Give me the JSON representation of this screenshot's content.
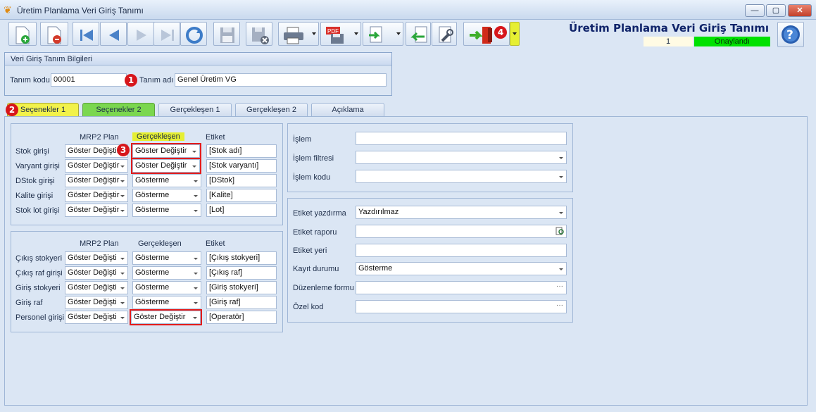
{
  "window": {
    "title": "Üretim Planlama Veri Giriş Tanımı",
    "min": "—",
    "max": "▢",
    "close": "✕"
  },
  "header": {
    "title": "Üretim Planlama Veri Giriş Tanımı",
    "record_no": "1",
    "status": "Onaylandı",
    "status_color": "#00e100"
  },
  "toolbar": {
    "buttons": [
      "new-icon",
      "delete-icon",
      "first-icon",
      "prev-icon",
      "next-icon",
      "last-icon",
      "refresh-icon",
      "save-icon",
      "cancel-save-icon",
      "print-icon",
      "pdf-export-icon",
      "import-icon",
      "back-icon",
      "settings-icon",
      "exit-icon"
    ],
    "pdf_label": "PDF"
  },
  "markers": {
    "m1": "1",
    "m2": "2",
    "m3": "3",
    "m4": "4"
  },
  "definition": {
    "group_title": "Veri Giriş Tanım Bilgileri",
    "code_label": "Tanım kodu",
    "code_value": "00001",
    "name_label": "Tanım adı",
    "name_value": "Genel Üretim VG"
  },
  "tabs": [
    "Seçenekler 1",
    "Seçenekler 2",
    "Gerçekleşen 1",
    "Gerçekleşen 2",
    "Açıklama"
  ],
  "panel1": {
    "col_mrp": "MRP2 Plan",
    "col_gerc": "Gerçekleşen",
    "col_etiket": "Etiket",
    "rows": [
      {
        "label": "Stok girişi",
        "mrp": "Göster Değiştir",
        "gerc": "Göster Değiştir",
        "etiket": "[Stok adı]"
      },
      {
        "label": "Varyant girişi",
        "mrp": "Göster Değiştir",
        "gerc": "Göster Değiştir",
        "etiket": "[Stok varyantı]"
      },
      {
        "label": "DStok girişi",
        "mrp": "Göster Değiştir",
        "gerc": "Gösterme",
        "etiket": "[DStok]"
      },
      {
        "label": "Kalite girişi",
        "mrp": "Göster Değiştir",
        "gerc": "Gösterme",
        "etiket": "[Kalite]"
      },
      {
        "label": "Stok lot girişi",
        "mrp": "Göster Değiştir",
        "gerc": "Gösterme",
        "etiket": "[Lot]"
      }
    ]
  },
  "panel2": {
    "col_mrp": "MRP2 Plan",
    "col_gerc": "Gerçekleşen",
    "col_etiket": "Etiket",
    "rows": [
      {
        "label": "Çıkış stokyeri",
        "mrp": "Göster Değişti",
        "gerc": "Gösterme",
        "etiket": "[Çıkış stokyeri]"
      },
      {
        "label": "Çıkış raf girişi",
        "mrp": "Göster Değişti",
        "gerc": "Gösterme",
        "etiket": "[Çıkış raf]"
      },
      {
        "label": "Giriş stokyeri",
        "mrp": "Göster Değişti",
        "gerc": "Gösterme",
        "etiket": "[Giriş stokyeri]"
      },
      {
        "label": "Giriş raf",
        "mrp": "Göster Değişti",
        "gerc": "Gösterme",
        "etiket": "[Giriş raf]"
      },
      {
        "label": "Personel girişi",
        "mrp": "Göster Değişti",
        "gerc": "Göster Değiştir",
        "etiket": "[Operatör]"
      }
    ]
  },
  "islem": {
    "islem_label": "İşlem",
    "islem_value": "",
    "filtre_label": "İşlem filtresi",
    "filtre_value": "",
    "kod_label": "İşlem kodu",
    "kod_value": ""
  },
  "etiket": {
    "yazdirma_label": "Etiket yazdırma",
    "yazdirma_value": "Yazdırılmaz",
    "rapor_label": "Etiket raporu",
    "rapor_value": "",
    "yeri_label": "Etiket yeri",
    "yeri_value": "",
    "kayit_label": "Kayıt durumu",
    "kayit_value": "Gösterme",
    "duzenleme_label": "Düzenleme formu",
    "duzenleme_value": "",
    "ozel_label": "Özel kod",
    "ozel_value": ""
  }
}
